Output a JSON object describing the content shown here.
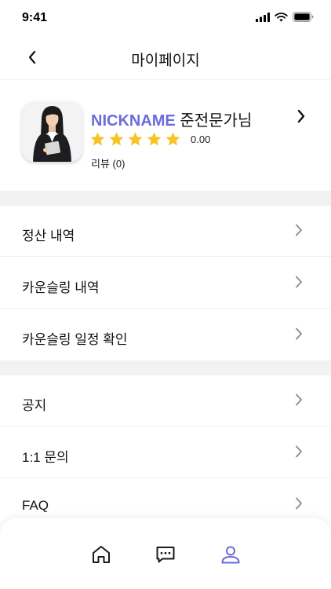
{
  "status_bar": {
    "time": "9:41"
  },
  "header": {
    "title": "마이페이지"
  },
  "profile": {
    "nickname": "NICKNAME",
    "rank": " 준전문가님",
    "rating": "0.00",
    "stars_filled": 5,
    "reviews": "리뷰 (0)"
  },
  "menu_group_1": [
    {
      "label": "정산 내역"
    },
    {
      "label": "카운슬링 내역"
    },
    {
      "label": "카운슬링 일정 확인"
    }
  ],
  "menu_group_2": [
    {
      "label": "공지"
    },
    {
      "label": "1:1 문의"
    },
    {
      "label": "FAQ"
    }
  ],
  "tab_bar": {
    "tabs": [
      {
        "icon": "home-icon",
        "active": false
      },
      {
        "icon": "chat-icon",
        "active": false
      },
      {
        "icon": "user-icon",
        "active": true
      }
    ]
  },
  "colors": {
    "accent": "#6b6bdc",
    "star": "#f7c325",
    "band": "#f2f2f2"
  }
}
